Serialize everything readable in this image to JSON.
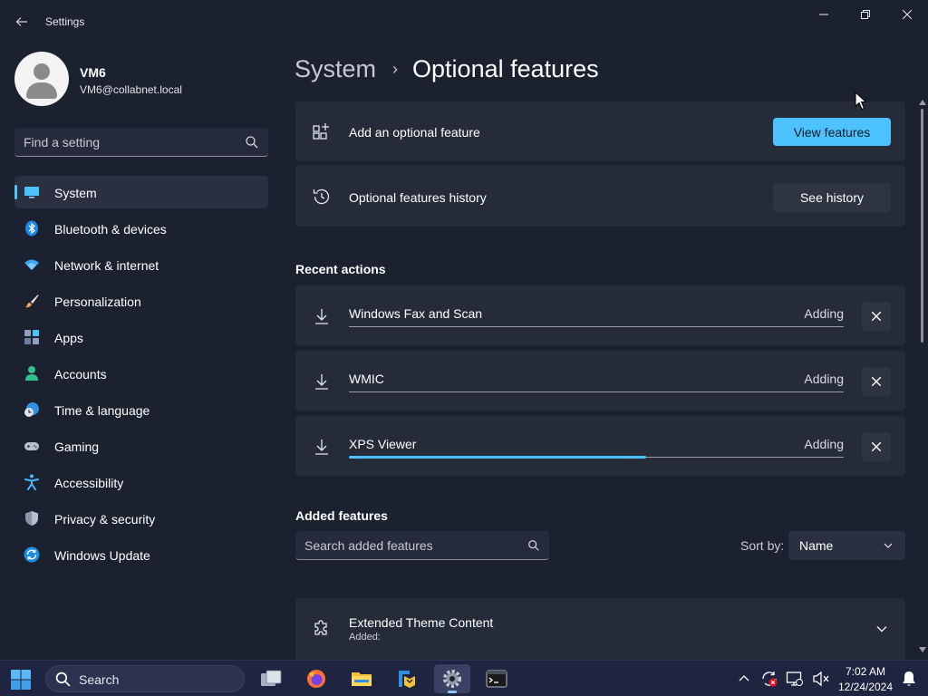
{
  "app": {
    "title": "Settings"
  },
  "profile": {
    "name": "VM6",
    "email": "VM6@collabnet.local"
  },
  "search": {
    "placeholder": "Find a setting"
  },
  "sidebar": {
    "items": [
      {
        "label": "System",
        "icon": "monitor-icon",
        "active": true
      },
      {
        "label": "Bluetooth & devices",
        "icon": "bluetooth-icon"
      },
      {
        "label": "Network & internet",
        "icon": "wifi-icon"
      },
      {
        "label": "Personalization",
        "icon": "brush-icon"
      },
      {
        "label": "Apps",
        "icon": "apps-icon"
      },
      {
        "label": "Accounts",
        "icon": "person-icon"
      },
      {
        "label": "Time & language",
        "icon": "globe-clock-icon"
      },
      {
        "label": "Gaming",
        "icon": "gamepad-icon"
      },
      {
        "label": "Accessibility",
        "icon": "accessibility-icon"
      },
      {
        "label": "Privacy & security",
        "icon": "shield-icon"
      },
      {
        "label": "Windows Update",
        "icon": "update-icon"
      }
    ]
  },
  "breadcrumb": {
    "parent": "System",
    "separator": "›",
    "current": "Optional features"
  },
  "main": {
    "add_feature": {
      "label": "Add an optional feature",
      "button": "View features",
      "icon": "add-feature-icon"
    },
    "history": {
      "label": "Optional features history",
      "button": "See history",
      "icon": "history-icon"
    },
    "recent_actions_title": "Recent actions",
    "recent_actions": [
      {
        "name": "Windows Fax and Scan",
        "status": "Adding",
        "progress": 0
      },
      {
        "name": "WMIC",
        "status": "Adding",
        "progress": 0
      },
      {
        "name": "XPS Viewer",
        "status": "Adding",
        "progress": 0.6
      }
    ],
    "added_features_title": "Added features",
    "search_added": {
      "placeholder": "Search added features"
    },
    "sort": {
      "label": "Sort by:",
      "value": "Name"
    },
    "added_features": [
      {
        "name": "Extended Theme Content",
        "detail": "Added:"
      }
    ]
  },
  "taskbar": {
    "search_label": "Search",
    "time": "7:02 AM",
    "date": "12/24/2024"
  },
  "colors": {
    "accent": "#4cc2ff",
    "background": "#1c2130",
    "card": "#262b3a"
  }
}
